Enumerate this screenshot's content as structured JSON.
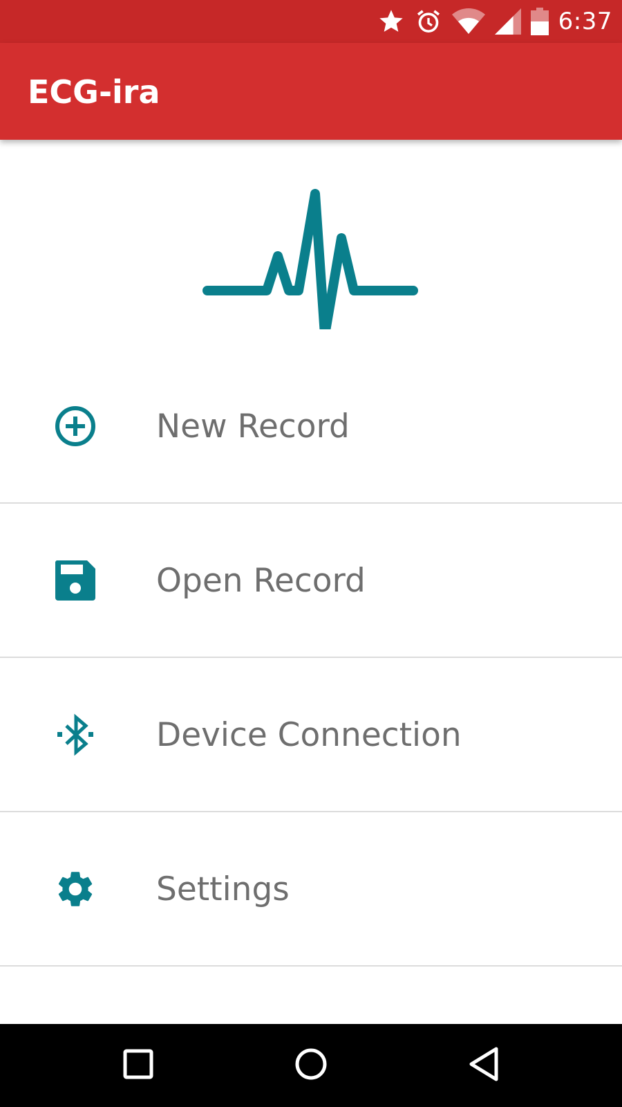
{
  "status_bar": {
    "time": "6:37",
    "icons": [
      "star-icon",
      "alarm-icon",
      "wifi-icon",
      "signal-icon",
      "battery-icon"
    ]
  },
  "app_bar": {
    "title": "ECG-ira"
  },
  "hero": {
    "icon": "ecg-pulse-icon"
  },
  "menu": {
    "items": [
      {
        "label": "New Record",
        "icon": "add-circle-icon"
      },
      {
        "label": "Open Record",
        "icon": "floppy-disk-icon"
      },
      {
        "label": "Device Connection",
        "icon": "bluetooth-searching-icon"
      },
      {
        "label": "Settings",
        "icon": "gear-icon"
      }
    ]
  },
  "nav_bar": {
    "buttons": [
      "recents-icon",
      "home-icon",
      "back-icon"
    ]
  },
  "colors": {
    "status_bar": "#c62828",
    "app_bar": "#d32f2f",
    "accent": "#0a7f8c",
    "menu_text": "#6e6e6e",
    "divider": "#dcdcdc"
  }
}
